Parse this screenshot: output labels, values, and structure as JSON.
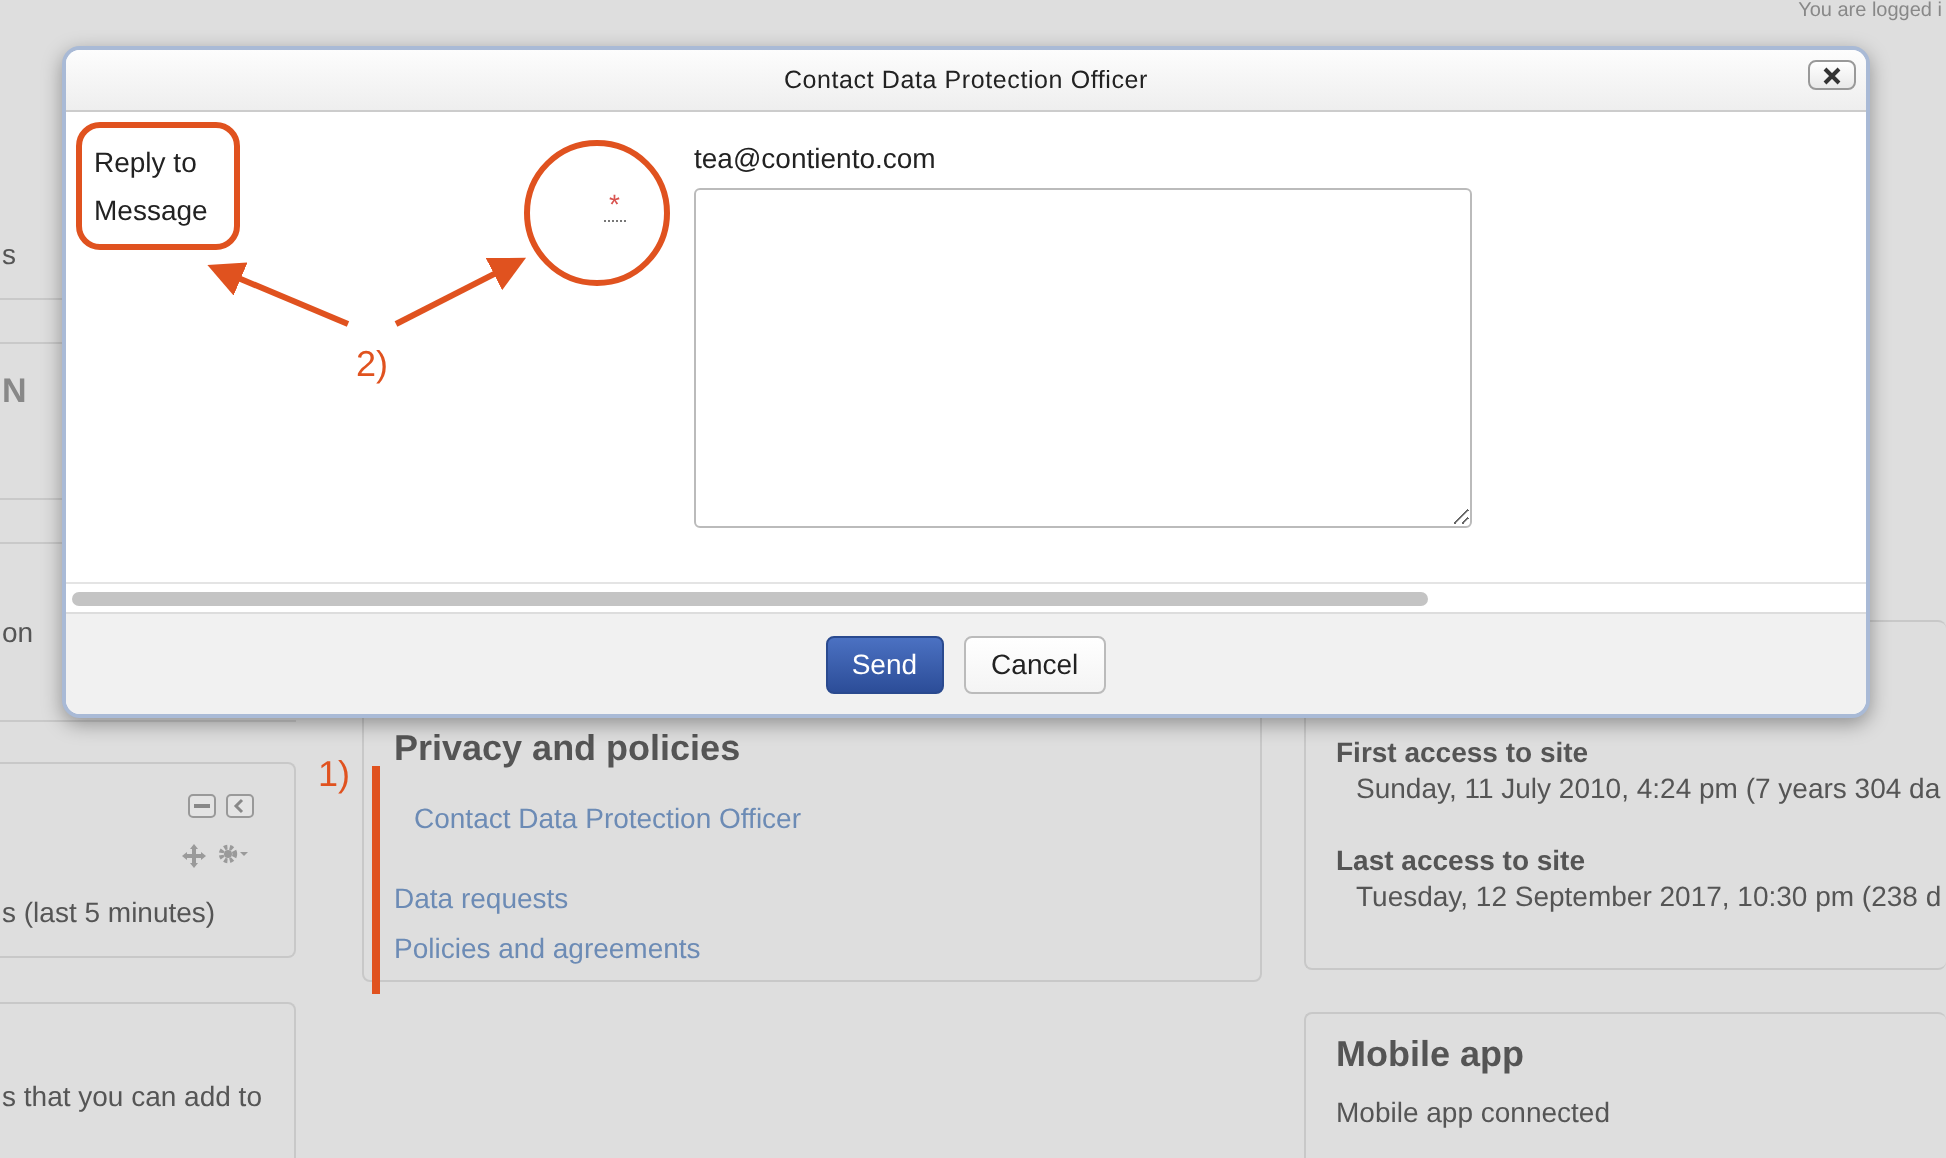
{
  "page": {
    "header": {
      "login_text": "You are logged i"
    },
    "left_column": {
      "fragments": [
        "s",
        "N",
        "on"
      ],
      "online_block": {
        "text": "s (last 5 minutes)"
      },
      "blocks_block": {
        "text": "s that you can add to"
      }
    },
    "privacy_block": {
      "title": "Privacy and policies",
      "links": [
        {
          "label": "Contact Data Protection Officer",
          "indented": true
        },
        {
          "label": "Data requests",
          "indented": false
        },
        {
          "label": "Policies and agreements",
          "indented": false
        }
      ]
    },
    "access_block": {
      "items": [
        {
          "label": "First access to site",
          "value": "Sunday, 11 July 2010, 4:24 pm  (7 years 304 da"
        },
        {
          "label": "Last access to site",
          "value": "Tuesday, 12 September 2017, 10:30 pm  (238 d"
        }
      ]
    },
    "mobile_block": {
      "title": "Mobile app",
      "text": "Mobile app connected"
    }
  },
  "dialog": {
    "title": "Contact Data Protection Officer",
    "form": {
      "label": "Reply to Message",
      "required_mark": "*",
      "email": "tea@contiento.com"
    },
    "buttons": [
      {
        "label": "Send",
        "kind": "primary"
      },
      {
        "label": "Cancel",
        "kind": "default"
      }
    ]
  },
  "annotations": {
    "labels": [
      "1)",
      "2)"
    ]
  }
}
